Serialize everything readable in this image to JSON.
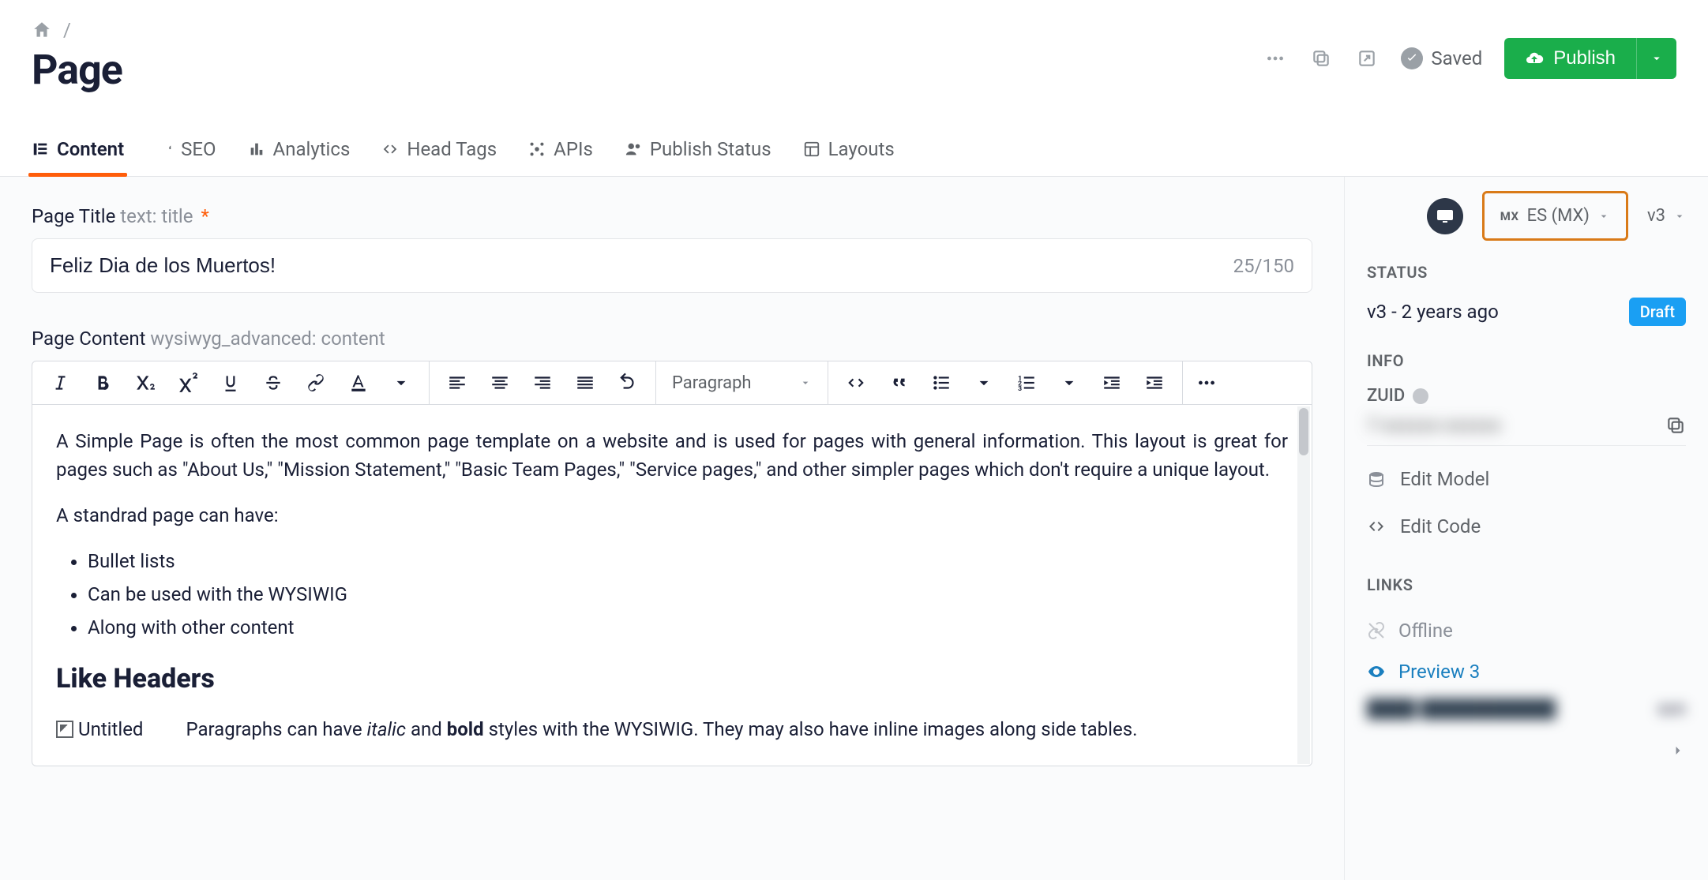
{
  "breadcrumb": {
    "separator": "/"
  },
  "header": {
    "title": "Page",
    "saved_label": "Saved",
    "publish_label": "Publish"
  },
  "tabs": [
    {
      "label": "Content"
    },
    {
      "label": "SEO"
    },
    {
      "label": "Analytics"
    },
    {
      "label": "Head Tags"
    },
    {
      "label": "APIs"
    },
    {
      "label": "Publish Status"
    },
    {
      "label": "Layouts"
    }
  ],
  "title_field": {
    "label": "Page Title",
    "meta": "text: title",
    "required_marker": "*",
    "value": "Feliz Dia de los Muertos!",
    "count": "25/150"
  },
  "content_field": {
    "label": "Page Content",
    "meta": "wysiwyg_advanced: content",
    "format_select": "Paragraph",
    "body": {
      "p1": "A Simple Page is often the most common page template on a website and is used for pages with general information. This layout is great for pages such as \"About Us,\" \"Mission Statement,\" \"Basic Team Pages,\" \"Service pages,\" and other simpler pages which don't require a unique layout.",
      "p2": "A standrad page can have:",
      "bullets": [
        "Bullet lists",
        "Can be used with the WYSIWIG",
        "Along with other content"
      ],
      "h2": "Like Headers",
      "img_alt": "Untitled",
      "p3_prefix": "Paragraphs can have ",
      "p3_italic": "italic",
      "p3_mid": " and ",
      "p3_bold": "bold",
      "p3_suffix": " styles with the WYSIWIG. They may also have inline images along side tables."
    }
  },
  "rail": {
    "locale_prefix": "MX",
    "locale": "ES (MX)",
    "version": "v3",
    "status_label": "STATUS",
    "status_text": "v3 - 2 years ago",
    "draft_badge": "Draft",
    "info_label": "INFO",
    "zuid_label": "ZUID",
    "zuid_value": "7-xxxxxx-xxxxxx",
    "edit_model": "Edit Model",
    "edit_code": "Edit Code",
    "links_label": "LINKS",
    "offline": "Offline",
    "preview": "Preview 3",
    "blur_suffix": "son"
  }
}
